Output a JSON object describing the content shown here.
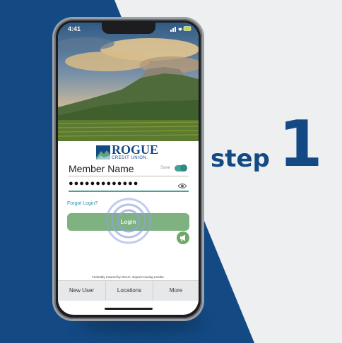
{
  "marketing": {
    "step_word": "step",
    "step_number": "1"
  },
  "status_bar": {
    "time": "4:41"
  },
  "brand": {
    "name": "ROGUE",
    "subtitle": "CREDIT UNION."
  },
  "login_form": {
    "username_value": "Member Name",
    "save_label": "Save",
    "password_value": "●●●●●●●●●●●●●",
    "forgot_link": "Forgot Login?",
    "login_button": "Login"
  },
  "footer": {
    "disclaimer": "Federally Insured by NCUA. Equal Housing Lender."
  },
  "tabs": [
    {
      "label": "New User"
    },
    {
      "label": "Locations"
    },
    {
      "label": "More"
    }
  ],
  "colors": {
    "brand_blue": "#134a84",
    "accent_teal": "#4ba096",
    "login_green": "#7fb281"
  }
}
